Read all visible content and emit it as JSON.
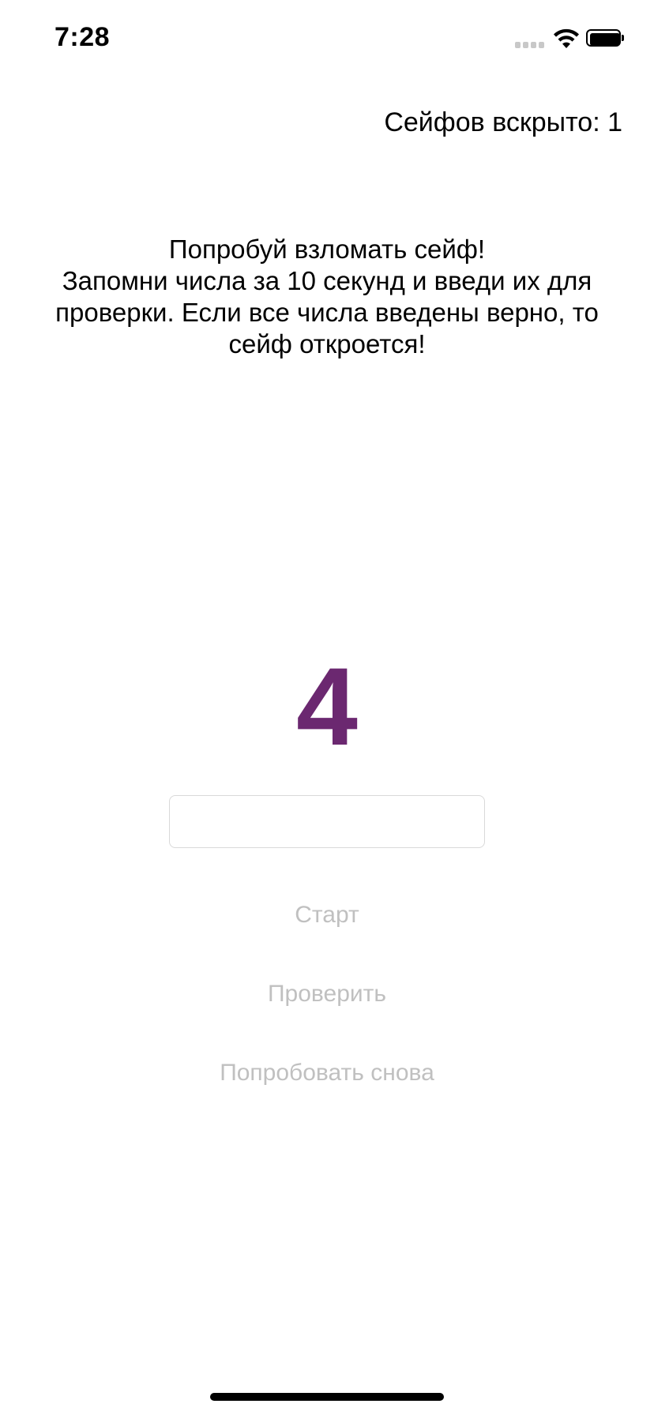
{
  "status_bar": {
    "time": "7:28",
    "icons": [
      "signal-icon",
      "wifi-icon",
      "battery-icon"
    ]
  },
  "header": {
    "counter_label": "Сейфов вскрыто: 1"
  },
  "instructions": {
    "lines": [
      "Попробуй взломать сейф!",
      "Запомни числа за 10 секунд и введи их для",
      "проверки. Если все числа введены верно, то",
      "сейф откроется!"
    ]
  },
  "game": {
    "current_number": "4",
    "number_color": "#6b2870",
    "input": {
      "value": "",
      "placeholder": ""
    },
    "buttons": {
      "start_label": "Старт",
      "check_label": "Проверить",
      "retry_label": "Попробовать снова"
    },
    "disabled_button_color": "#c0c0c0"
  }
}
